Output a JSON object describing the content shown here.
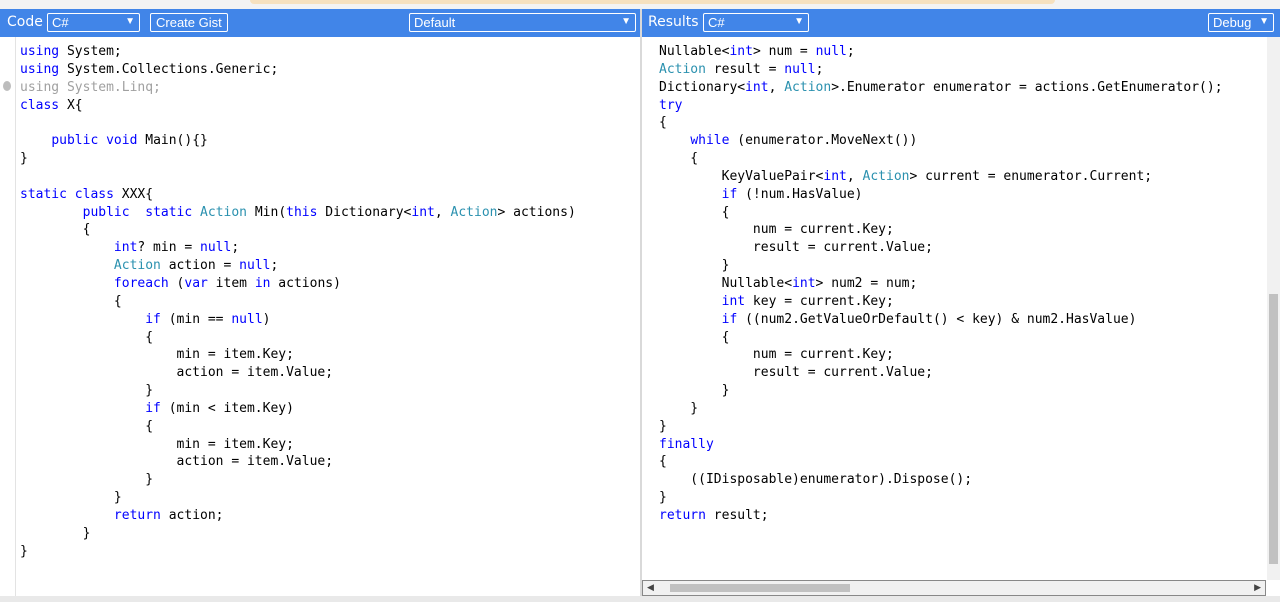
{
  "code_toolbar": {
    "label": "Code",
    "language": "C#",
    "create_gist": "Create Gist",
    "mode": "Default"
  },
  "results_toolbar": {
    "label": "Results",
    "language": "C#",
    "build": "Debug"
  },
  "colors": {
    "toolbar_bg": "#4185e8",
    "keyword": "#0000ff",
    "type": "#2b91af"
  },
  "code_lines": [
    "using System;",
    "using System.Collections.Generic;",
    "using System.Linq;",
    "class X{",
    "",
    "    public void Main(){}",
    "}",
    "",
    "static class XXX{",
    "        public  static Action Min(this Dictionary<int, Action> actions)",
    "        {",
    "            int? min = null;",
    "            Action action = null;",
    "            foreach (var item in actions)",
    "            {",
    "                if (min == null)",
    "                {",
    "                    min = item.Key;",
    "                    action = item.Value;",
    "                }",
    "                if (min < item.Key)",
    "                {",
    "                    min = item.Key;",
    "                    action = item.Value;",
    "                }",
    "            }",
    "            return action;",
    "        }",
    "}"
  ],
  "result_lines": [
    "Nullable<int> num = null;",
    "Action result = null;",
    "Dictionary<int, Action>.Enumerator enumerator = actions.GetEnumerator();",
    "try",
    "{",
    "    while (enumerator.MoveNext())",
    "    {",
    "        KeyValuePair<int, Action> current = enumerator.Current;",
    "        if (!num.HasValue)",
    "        {",
    "            num = current.Key;",
    "            result = current.Value;",
    "        }",
    "        Nullable<int> num2 = num;",
    "        int key = current.Key;",
    "        if ((num2.GetValueOrDefault() < key) & num2.HasValue)",
    "        {",
    "            num = current.Key;",
    "            result = current.Value;",
    "        }",
    "    }",
    "}",
    "finally",
    "{",
    "    ((IDisposable)enumerator).Dispose();",
    "}",
    "return result;"
  ]
}
